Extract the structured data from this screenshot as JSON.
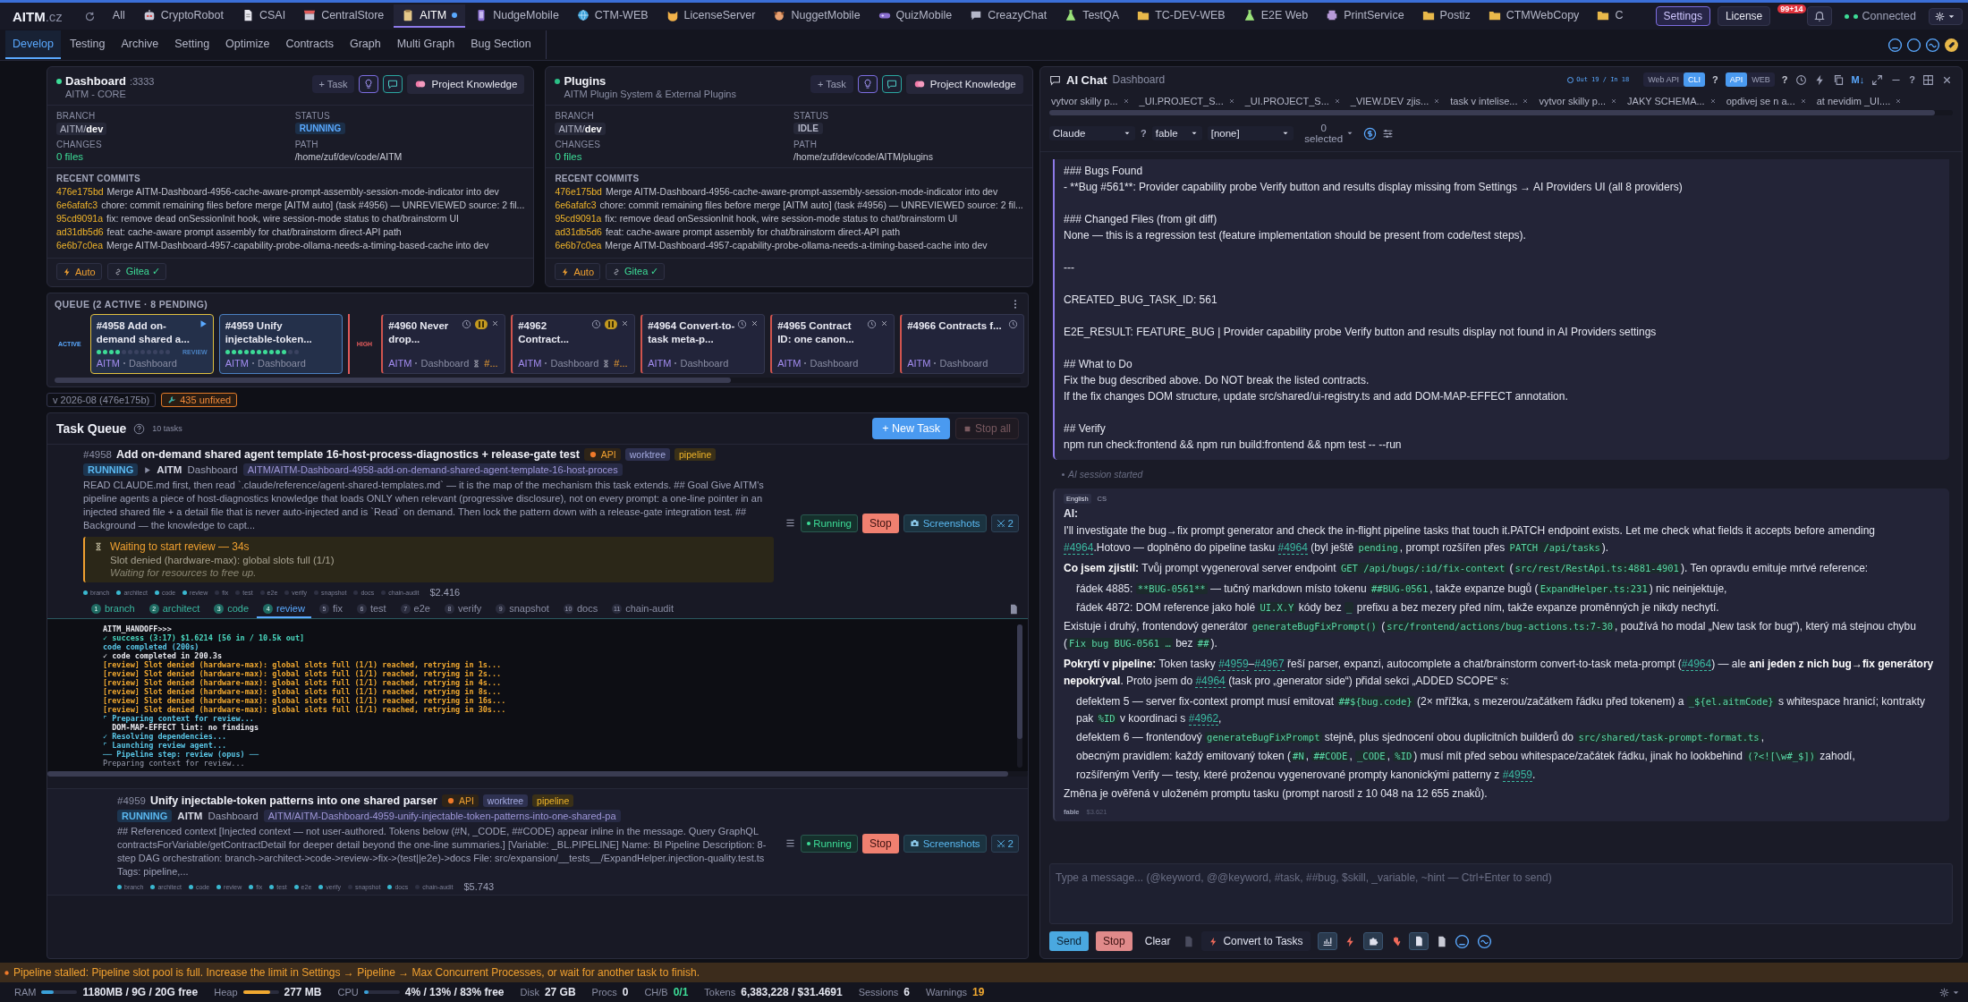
{
  "app": {
    "logo": "AITM",
    "logo_suffix": ".cz"
  },
  "project_tabs": [
    {
      "label": "All",
      "kind": "none",
      "selected": false,
      "dot": false
    },
    {
      "label": "CryptoRobot",
      "kind": "robot",
      "selected": false,
      "dot": false
    },
    {
      "label": "CSAI",
      "kind": "doc",
      "selected": false,
      "dot": false
    },
    {
      "label": "CentralStore",
      "kind": "store",
      "selected": false,
      "dot": false
    },
    {
      "label": "AITM",
      "kind": "clipboard",
      "selected": true,
      "dot": true
    },
    {
      "label": "NudgeMobile",
      "kind": "phone",
      "selected": false,
      "dot": false
    },
    {
      "label": "CTM-WEB",
      "kind": "globe",
      "selected": false,
      "dot": false
    },
    {
      "label": "LicenseServer",
      "kind": "cat",
      "selected": false,
      "dot": false
    },
    {
      "label": "NuggetMobile",
      "kind": "dog",
      "selected": false,
      "dot": false
    },
    {
      "label": "QuizMobile",
      "kind": "gamepad",
      "selected": false,
      "dot": false
    },
    {
      "label": "CreazyChat",
      "kind": "chat",
      "selected": false,
      "dot": false
    },
    {
      "label": "TestQA",
      "kind": "flask",
      "selected": false,
      "dot": false
    },
    {
      "label": "TC-DEV-WEB",
      "kind": "folder",
      "selected": false,
      "dot": false
    },
    {
      "label": "E2E Web",
      "kind": "flask",
      "selected": false,
      "dot": false
    },
    {
      "label": "PrintService",
      "kind": "printer",
      "selected": false,
      "dot": false
    },
    {
      "label": "Postiz",
      "kind": "folder",
      "selected": false,
      "dot": false
    },
    {
      "label": "CTMWebCopy",
      "kind": "folder",
      "selected": false,
      "dot": false
    },
    {
      "label": "C",
      "kind": "folder",
      "selected": false,
      "dot": false
    }
  ],
  "header_right": {
    "settings": "Settings",
    "license": "License",
    "notifications": "99+14",
    "connection": "Connected",
    "connected": true
  },
  "nav_tabs": [
    {
      "label": "Develop",
      "selected": true
    },
    {
      "label": "Testing",
      "selected": false
    },
    {
      "label": "Archive",
      "selected": false
    },
    {
      "label": "Setting",
      "selected": false
    },
    {
      "label": "Optimize",
      "selected": false
    },
    {
      "label": "Contracts",
      "selected": false
    },
    {
      "label": "Graph",
      "selected": false
    },
    {
      "label": "Multi Graph",
      "selected": false
    },
    {
      "label": "Bug Section",
      "selected": false
    }
  ],
  "repos": [
    {
      "name": "Dashboard",
      "port": ":3333",
      "subtitle": "AITM - CORE",
      "task_button": "+ Task",
      "knowledge_button": "Project Knowledge",
      "branch_label": "BRANCH",
      "branch": "AITM/**dev**",
      "status_label": "STATUS",
      "status": "RUNNING",
      "running": true,
      "changes_label": "CHANGES",
      "changes": "0 files",
      "path_label": "PATH",
      "path": "/home/zuf/dev/code/AITM",
      "commits_label": "RECENT COMMITS",
      "commits": [
        {
          "hash": "476e175bd",
          "message": "Merge AITM-Dashboard-4956-cache-aware-prompt-assembly-session-mode-indicator into dev"
        },
        {
          "hash": "6e6afafc3",
          "message": "chore: commit remaining files before merge [AITM auto] (task #4956) — UNREVIEWED source: 2 fil..."
        },
        {
          "hash": "95cd9091a",
          "message": "fix: remove dead onSessionInit hook, wire session-mode status to chat/brainstorm UI"
        },
        {
          "hash": "ad31db5d6",
          "message": "feat: cache-aware prompt assembly for chat/brainstorm direct-API path"
        },
        {
          "hash": "6e6b7c0ea",
          "message": "Merge AITM-Dashboard-4957-capability-probe-ollama-needs-a-timing-based-cache into dev"
        }
      ],
      "auto": "Auto",
      "gitea": "Gitea ✓"
    },
    {
      "name": "Plugins",
      "subtitle": "AITM Plugin System & External Plugins",
      "task_button": "+ Task",
      "knowledge_button": "Project Knowledge",
      "branch_label": "BRANCH",
      "branch": "AITM/**dev**",
      "status_label": "STATUS",
      "status": "IDLE",
      "running": false,
      "changes_label": "CHANGES",
      "changes": "0 files",
      "path_label": "PATH",
      "path": "/home/zuf/dev/code/AITM/plugins",
      "commits_label": "RECENT COMMITS",
      "commits": [
        {
          "hash": "476e175bd",
          "message": "Merge AITM-Dashboard-4956-cache-aware-prompt-assembly-session-mode-indicator into dev"
        },
        {
          "hash": "6e6afafc3",
          "message": "chore: commit remaining files before merge [AITM auto] (task #4956) — UNREVIEWED source: 2 fil..."
        },
        {
          "hash": "95cd9091a",
          "message": "fix: remove dead onSessionInit hook, wire session-mode status to chat/brainstorm UI"
        },
        {
          "hash": "ad31db5d6",
          "message": "feat: cache-aware prompt assembly for chat/brainstorm direct-API path"
        },
        {
          "hash": "6e6b7c0ea",
          "message": "Merge AITM-Dashboard-4957-capability-probe-ollama-needs-a-timing-based-cache into dev"
        }
      ],
      "auto": "Auto",
      "gitea": "Gitea ✓"
    }
  ],
  "queue": {
    "title": "QUEUE (2 ACTIVE · 8 PENDING)",
    "lanes": [
      {
        "label": "ACTIVE",
        "kind": "active",
        "cards": [
          {
            "title": "#4958 Add on-demand shared a...",
            "project": "AITM",
            "module": "Dashboard",
            "level": 0.33,
            "stage": "REVIEW"
          },
          {
            "title": "#4959 Unify injectable-token...",
            "project": "AITM",
            "module": "Dashboard",
            "level": 0.8
          }
        ]
      },
      {
        "label": "HIGH",
        "kind": "high",
        "cards": [
          {
            "title": "#4960 Never drop...",
            "project": "AITM",
            "module": "Dashboard",
            "paused": true,
            "closable": true,
            "wait": "#..."
          },
          {
            "title": "#4962 Contract...",
            "project": "AITM",
            "module": "Dashboard",
            "paused": true,
            "closable": true,
            "wait": "#..."
          },
          {
            "title": "#4964 Convert-to-task meta-p...",
            "project": "AITM",
            "module": "Dashboard",
            "paused": false,
            "closable": true
          },
          {
            "title": "#4965 Contract ID: one canon...",
            "project": "AITM",
            "module": "Dashboard",
            "paused": false,
            "closable": true
          },
          {
            "title": "#4966 Contracts f...",
            "project": "AITM",
            "module": "Dashboard",
            "paused": false,
            "closable": false
          }
        ]
      }
    ]
  },
  "version": "v 2026-08 (476e175b)",
  "unfixed": "435 unfixed",
  "task_queue": {
    "title": "Task Queue",
    "count": "10 tasks",
    "new_task": "+ New Task",
    "stop_all": "Stop all",
    "tasks": [
      {
        "id": "#4958",
        "title": "Add on-demand shared agent template 16-host-process-diagnostics + release-gate test",
        "tags": [
          "API",
          "worktree",
          "pipeline"
        ],
        "status": "RUNNING",
        "project": "AITM",
        "module": "Dashboard",
        "branch": "AITM/AITM-Dashboard-4958-add-on-demand-shared-agent-template-16-host-proces",
        "playing": true,
        "description": "READ CLAUDE.md first, then read `.claude/reference/agent-shared-templates.md` — it is the map of the mechanism this task extends. ## Goal Give AITM's pipeline agents a piece of host-diagnostics knowledge that loads ONLY when relevant (progressive disclosure), not on every prompt: a one-line pointer in an injected shared file + a detail file that is never auto-injected and is `Read` on demand. Then lock the pattern down with a release-gate integration test. ## Background — the knowledge to capt...",
        "wait": {
          "title": "Waiting to start review — 34s",
          "detail": "Slot denied (hardware-max): global slots full (1/1)",
          "note": "Waiting for resources to free up."
        },
        "steps": [
          {
            "label": "branch",
            "done": true
          },
          {
            "label": "architect",
            "done": true
          },
          {
            "label": "code",
            "done": true
          },
          {
            "label": "review",
            "done": true
          },
          {
            "label": "fix",
            "done": false
          },
          {
            "label": "test",
            "done": false
          },
          {
            "label": "e2e",
            "done": false
          },
          {
            "label": "verify",
            "done": false
          },
          {
            "label": "snapshot",
            "done": false
          },
          {
            "label": "docs",
            "done": false
          },
          {
            "label": "chain-audit",
            "done": false
          }
        ],
        "cost": "$2.416",
        "running": "Running",
        "stop": "Stop",
        "screenshots": "Screenshots",
        "agents": "2",
        "step_tabs": [
          {
            "number": "1",
            "label": "branch",
            "done": true,
            "selected": false
          },
          {
            "number": "2",
            "label": "architect",
            "done": true,
            "selected": false
          },
          {
            "number": "3",
            "label": "code",
            "done": true,
            "selected": false
          },
          {
            "number": "4",
            "label": "review",
            "done": true,
            "selected": true
          },
          {
            "number": "5",
            "label": "fix",
            "done": false,
            "selected": false
          },
          {
            "number": "6",
            "label": "test",
            "done": false,
            "selected": false
          },
          {
            "number": "7",
            "label": "e2e",
            "done": false,
            "selected": false
          },
          {
            "number": "8",
            "label": "verify",
            "done": false,
            "selected": false
          },
          {
            "number": "9",
            "label": "snapshot",
            "done": false,
            "selected": false
          },
          {
            "number": "10",
            "label": "docs",
            "done": false,
            "selected": false
          },
          {
            "number": "11",
            "label": "chain-audit",
            "done": false,
            "selected": false
          }
        ],
        "log": [
          {
            "kind": "plain",
            "text": "AITM_HANDOFF>>>"
          },
          {
            "kind": "success",
            "text": "✓ success (3:17) $1.6214 [56 in / 10.5k out]"
          },
          {
            "kind": "info",
            "text": "code completed (200s)"
          },
          {
            "kind": "plain",
            "text": "✓ code completed in 200.3s"
          },
          {
            "kind": "warn",
            "text": "[review] Slot denied (hardware-max): global slots full (1/1) reached, retrying in 1s..."
          },
          {
            "kind": "warn",
            "text": "[review] Slot denied (hardware-max): global slots full (1/1) reached, retrying in 2s..."
          },
          {
            "kind": "warn",
            "text": "[review] Slot denied (hardware-max): global slots full (1/1) reached, retrying in 4s..."
          },
          {
            "kind": "warn",
            "text": "[review] Slot denied (hardware-max): global slots full (1/1) reached, retrying in 8s..."
          },
          {
            "kind": "warn",
            "text": "[review] Slot denied (hardware-max): global slots full (1/1) reached, retrying in 16s..."
          },
          {
            "kind": "warn",
            "text": "[review] Slot denied (hardware-max): global slots full (1/1) reached, retrying in 30s..."
          },
          {
            "kind": "info",
            "text": "⌜ Preparing context for review..."
          },
          {
            "kind": "plain",
            "text": "  DOM-MAP-EFFECT lint: no findings"
          },
          {
            "kind": "info",
            "text": "✓ Resolving dependencies..."
          },
          {
            "kind": "info",
            "text": "⌜ Launching review agent..."
          },
          {
            "kind": "info",
            "text": "── Pipeline step: review (opus) ──"
          },
          {
            "kind": "dim",
            "text": "Preparing context for review..."
          }
        ]
      },
      {
        "id": "#4959",
        "title": "Unify injectable-token patterns into one shared parser",
        "tags": [
          "API",
          "worktree",
          "pipeline"
        ],
        "status": "RUNNING",
        "project": "AITM",
        "module": "Dashboard",
        "branch": "AITM/AITM-Dashboard-4959-unify-injectable-token-patterns-into-one-shared-pa",
        "playing": false,
        "description": "## Referenced context [Injected context — not user-authored. Tokens below (#N, _CODE, ##CODE) appear inline in the message. Query GraphQL contractsForVariable/getContractDetail for deeper detail beyond the one-line summaries.] [Variable: _BL.PIPELINE] Name: Bl Pipeline Description: 8-step DAG orchestration: branch->architect->code->review->fix->(test||e2e)->docs File: src/expansion/__tests__/ExpandHelper.injection-quality.test.ts Tags: pipeline,...",
        "steps": [
          {
            "label": "branch",
            "done": true
          },
          {
            "label": "architect",
            "done": true
          },
          {
            "label": "code",
            "done": true
          },
          {
            "label": "review",
            "done": true
          },
          {
            "label": "fix",
            "done": true
          },
          {
            "label": "test",
            "done": true
          },
          {
            "label": "e2e",
            "done": true
          },
          {
            "label": "verify",
            "done": true
          },
          {
            "label": "snapshot",
            "done": false
          },
          {
            "label": "docs",
            "done": true
          },
          {
            "label": "chain-audit",
            "done": false
          }
        ],
        "cost": "$5.743",
        "running": "Running",
        "stop": "Stop",
        "screenshots": "Screenshots",
        "agents": "2"
      }
    ]
  },
  "chat": {
    "title": "AI Chat",
    "context": "Dashboard",
    "tokens": "Out 19 / In 18",
    "modes": [
      {
        "label": "Web API",
        "selected": false
      },
      {
        "label": "CLI",
        "selected": true
      }
    ],
    "modes_help": "?",
    "transports": [
      {
        "label": "API",
        "selected": true
      },
      {
        "label": "WEB",
        "selected": false
      }
    ],
    "transports_help": "?",
    "markdown": "M↓",
    "help": "?",
    "conversations": [
      "vytvor skilly p...",
      "_UI.PROJECT_S...",
      "_UI.PROJECT_S...",
      "_VIEW.DEV zjis...",
      "task v intelise...",
      "vytvor skilly p...",
      "JAKY SCHEMA...",
      "opdivej se n a...",
      "at nevidim _UI...."
    ],
    "model": "Claude",
    "model_help": "?",
    "profile": "fable",
    "preset": "[none]",
    "selection": "0 selected",
    "prompt_blocks": [
      [
        "### Bugs Found",
        "- **Bug #561**: Provider capability probe Verify button and results display missing from Settings → AI Providers UI (all 8 providers)"
      ],
      [
        "### Changed Files (from git diff)",
        "None — this is a regression test (feature implementation should be present from code/test steps)."
      ],
      [
        "---"
      ],
      [
        "CREATED_BUG_TASK_ID: 561"
      ],
      [
        "E2E_RESULT: FEATURE_BUG | Provider capability probe Verify button and results display not found in AI Providers settings"
      ],
      [
        "## What to Do",
        "Fix the bug described above. Do NOT break the listed contracts.",
        "If the fix changes DOM structure, update src/shared/ui-registry.ts and add DOM-MAP-EFFECT annotation."
      ],
      [
        "## Verify",
        "npm run check:frontend && npm run build:frontend && npm test -- --run"
      ]
    ],
    "session_note": "AI session started",
    "languages": [
      {
        "label": "English",
        "selected": true
      },
      {
        "label": "CS",
        "selected": false
      }
    ],
    "speaker": "AI:",
    "paragraphs": [
      {
        "indent": false,
        "parts": [
          {
            "kind": "text",
            "text": "I'll investigate the bug→fix prompt generator and check the in-flight pipeline tasks that touch it.PATCH endpoint exists. Let me check what fields it accepts before amending "
          },
          {
            "kind": "link",
            "text": "#4964"
          },
          {
            "kind": "text",
            "text": ".Hotovo — doplněno do pipeline tasku "
          },
          {
            "kind": "link",
            "text": "#4964"
          },
          {
            "kind": "text",
            "text": " (byl ještě "
          },
          {
            "kind": "code",
            "text": "pending"
          },
          {
            "kind": "text",
            "text": ", prompt rozšířen přes "
          },
          {
            "kind": "code",
            "text": "PATCH /api/tasks"
          },
          {
            "kind": "text",
            "text": ")."
          }
        ]
      },
      {
        "indent": false,
        "parts": [
          {
            "kind": "text",
            "text": "**Co jsem zjistil:** Tvůj prompt vygeneroval server endpoint "
          },
          {
            "kind": "code",
            "text": "GET /api/bugs/:id/fix-context"
          },
          {
            "kind": "text",
            "text": " ("
          },
          {
            "kind": "code",
            "text": "src/rest/RestApi.ts:4881-4901"
          },
          {
            "kind": "text",
            "text": "). Ten opravdu emituje mrtvé reference:"
          }
        ]
      },
      {
        "indent": true,
        "parts": [
          {
            "kind": "text",
            "text": "řádek 4885: "
          },
          {
            "kind": "code",
            "text": "**BUG-0561**"
          },
          {
            "kind": "text",
            "text": " — tučný markdown místo tokenu "
          },
          {
            "kind": "code",
            "text": "##BUG-0561"
          },
          {
            "kind": "text",
            "text": ", takže expanze bugů ("
          },
          {
            "kind": "code",
            "text": "ExpandHelper.ts:231"
          },
          {
            "kind": "text",
            "text": ") nic neinjektuje,"
          }
        ]
      },
      {
        "indent": true,
        "parts": [
          {
            "kind": "text",
            "text": "řádek 4872: DOM reference jako holé "
          },
          {
            "kind": "code",
            "text": "UI.X.Y"
          },
          {
            "kind": "text",
            "text": " kódy bez "
          },
          {
            "kind": "code",
            "text": "_"
          },
          {
            "kind": "text",
            "text": " prefixu a bez mezery před ním, takže expanze proměnných je nikdy nechytí."
          }
        ]
      },
      {
        "indent": false,
        "parts": [
          {
            "kind": "text",
            "text": "Existuje i druhý, frontendový generátor "
          },
          {
            "kind": "code",
            "text": "generateBugFixPrompt()"
          },
          {
            "kind": "text",
            "text": " ("
          },
          {
            "kind": "code",
            "text": "src/frontend/actions/bug-actions.ts:7-30"
          },
          {
            "kind": "text",
            "text": ", používá ho modal „New task for bug“), který má stejnou chybu ("
          },
          {
            "kind": "code",
            "text": "Fix bug BUG-0561 …"
          },
          {
            "kind": "text",
            "text": " bez "
          },
          {
            "kind": "code",
            "text": "##"
          },
          {
            "kind": "text",
            "text": ")."
          }
        ]
      },
      {
        "indent": false,
        "parts": [
          {
            "kind": "text",
            "text": "**Pokrytí v pipeline:** Token tasky "
          },
          {
            "kind": "link",
            "text": "#4959"
          },
          {
            "kind": "text",
            "text": "–"
          },
          {
            "kind": "link",
            "text": "#4967"
          },
          {
            "kind": "text",
            "text": " řeší parser, expanzi, autocomplete a chat/brainstorm convert-to-task meta-prompt ("
          },
          {
            "kind": "link",
            "text": "#4964"
          },
          {
            "kind": "text",
            "text": ") — ale **ani jeden z nich bug→fix generátory nepokrýval**. Proto jsem do "
          },
          {
            "kind": "link",
            "text": "#4964"
          },
          {
            "kind": "text",
            "text": " (task pro „generator side“) přidal sekci „ADDED SCOPE“ s:"
          }
        ]
      },
      {
        "indent": true,
        "parts": [
          {
            "kind": "text",
            "text": "defektem 5 — server fix-context prompt musí emitovat "
          },
          {
            "kind": "code",
            "text": "##${bug.code}"
          },
          {
            "kind": "text",
            "text": " (2× mřížka, s mezerou/začátkem řádku před tokenem) a "
          },
          {
            "kind": "code",
            "text": "_${el.aitmCode}"
          },
          {
            "kind": "text",
            "text": " s whitespace hranicí; kontrakty pak "
          },
          {
            "kind": "code",
            "text": "%ID"
          },
          {
            "kind": "text",
            "text": " v koordinaci s "
          },
          {
            "kind": "link",
            "text": "#4962"
          },
          {
            "kind": "text",
            "text": ","
          }
        ]
      },
      {
        "indent": true,
        "parts": [
          {
            "kind": "text",
            "text": "defektem 6 — frontendový "
          },
          {
            "kind": "code",
            "text": "generateBugFixPrompt"
          },
          {
            "kind": "text",
            "text": " stejně, plus sjednocení obou duplicitních builderů do "
          },
          {
            "kind": "code",
            "text": "src/shared/task-prompt-format.ts"
          },
          {
            "kind": "text",
            "text": ","
          }
        ]
      },
      {
        "indent": true,
        "parts": [
          {
            "kind": "text",
            "text": "obecným pravidlem: každý emitovaný token ("
          },
          {
            "kind": "code",
            "text": "#N"
          },
          {
            "kind": "text",
            "text": ", "
          },
          {
            "kind": "code",
            "text": "##CODE"
          },
          {
            "kind": "text",
            "text": ", "
          },
          {
            "kind": "code",
            "text": "_CODE"
          },
          {
            "kind": "text",
            "text": ", "
          },
          {
            "kind": "code",
            "text": "%ID"
          },
          {
            "kind": "text",
            "text": ") musí mít před sebou whitespace/začátek řádku, jinak ho lookbehind "
          },
          {
            "kind": "code",
            "text": "(?<![\\w#_$])"
          },
          {
            "kind": "text",
            "text": " zahodí,"
          }
        ]
      },
      {
        "indent": true,
        "parts": [
          {
            "kind": "text",
            "text": "rozšířeným Verify — testy, které proženou vygenerované prompty kanonickými patterny z "
          },
          {
            "kind": "link",
            "text": "#4959"
          },
          {
            "kind": "text",
            "text": "."
          }
        ]
      },
      {
        "indent": false,
        "parts": [
          {
            "kind": "text",
            "text": "Změna je ověřená v uloženém promptu tasku (prompt narostl z 10 048 na 12 655 znaků)."
          }
        ]
      }
    ],
    "footer_model": "fable",
    "footer_cost": "$3.621",
    "placeholder": "Type a message... (@keyword, @@keyword, #task, ##bug, $skill, _variable, ~hint — Ctrl+Enter to send)",
    "send": "Send",
    "stop": "Stop",
    "clear": "Clear",
    "convert": "Convert to Tasks"
  },
  "alert": "Pipeline stalled: Pipeline slot pool is full. Increase the limit in Settings → Pipeline → Max Concurrent Processes, or wait for another task to finish.",
  "status_bar": {
    "meters": [
      {
        "label": "RAM",
        "level": 0.35,
        "reading": "1180MB / 9G / 20G free",
        "color": "#3aa0d8"
      },
      {
        "label": "Heap",
        "level": 0.75,
        "reading": "277 MB",
        "color": "#f0a830"
      },
      {
        "label": "CPU",
        "level": 0.12,
        "reading": "4% / 13% / 83% free",
        "color": "#3aa0d8"
      }
    ],
    "stats": [
      {
        "label": "Disk",
        "value": "27 GB",
        "color": "#e4e6f0"
      },
      {
        "label": "Procs",
        "value": "0",
        "color": "#e4e6f0"
      },
      {
        "label": "CH/B",
        "value": "0/1",
        "color": "#3ddc97"
      },
      {
        "label": "Tokens",
        "value": "6,383,228 / $31.4691",
        "color": "#e4e6f0"
      },
      {
        "label": "Sessions",
        "value": "6",
        "color": "#e4e6f0"
      },
      {
        "label": "Warnings",
        "value": "19",
        "color": "#f0a830"
      }
    ]
  }
}
